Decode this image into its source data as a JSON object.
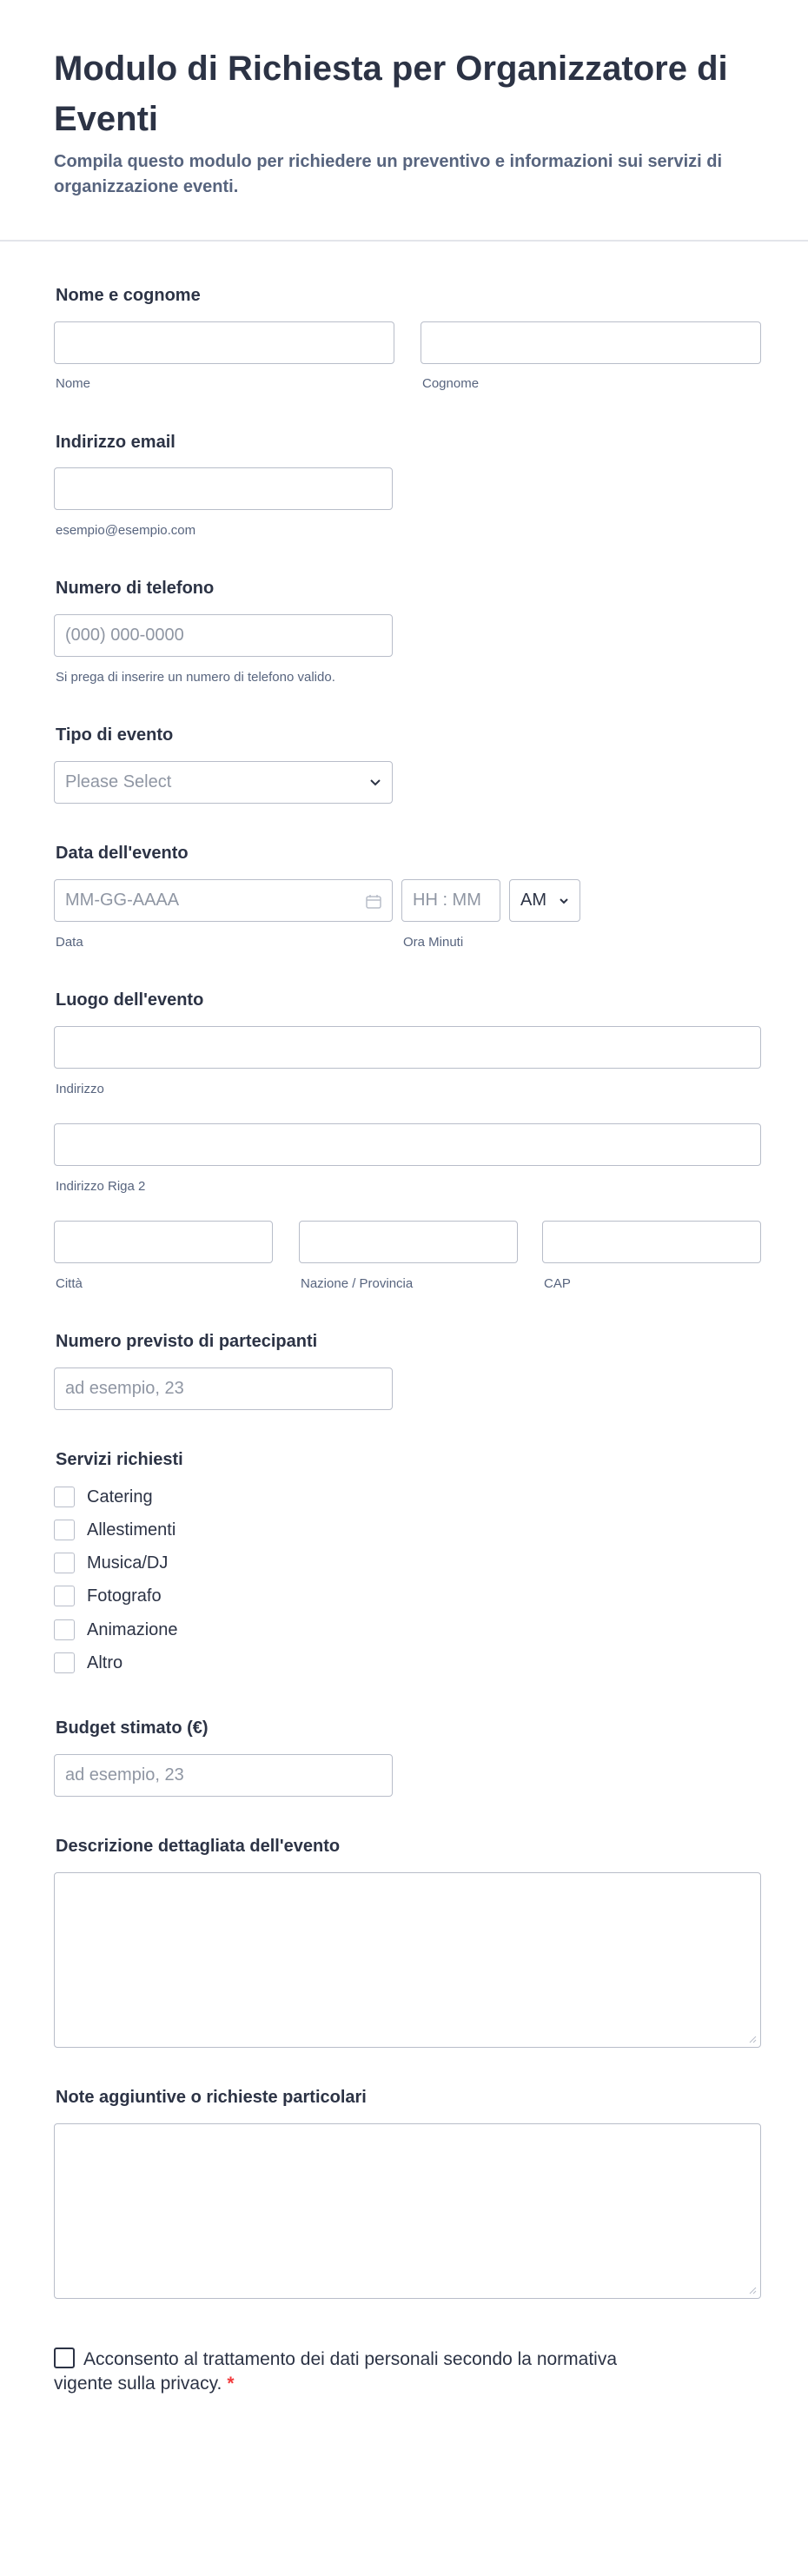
{
  "form": {
    "title": "Modulo di Richiesta per Organizzatore di Eventi",
    "subtitle": "Compila questo modulo per richiedere un preventivo e informazioni sui servizi di organizzazione eventi."
  },
  "name": {
    "label": "Nome e cognome",
    "first_sub": "Nome",
    "last_sub": "Cognome"
  },
  "email": {
    "label": "Indirizzo email",
    "sub": "esempio@esempio.com"
  },
  "phone": {
    "label": "Numero di telefono",
    "placeholder": "(000) 000-0000",
    "sub": "Si prega di inserire un numero di telefono valido."
  },
  "event_type": {
    "label": "Tipo di evento",
    "placeholder": "Please Select"
  },
  "event_date": {
    "label": "Data dell'evento",
    "date_placeholder": "MM-GG-AAAA",
    "time_placeholder": "HH : MM",
    "ampm": "AM",
    "date_sub": "Data",
    "time_sub": "Ora Minuti"
  },
  "location": {
    "label": "Luogo dell'evento",
    "line1_sub": "Indirizzo",
    "line2_sub": "Indirizzo Riga 2",
    "city_sub": "Città",
    "state_sub": "Nazione / Provincia",
    "zip_sub": "CAP"
  },
  "participants": {
    "label": "Numero previsto di partecipanti",
    "placeholder": "ad esempio, 23"
  },
  "services": {
    "label": "Servizi richiesti",
    "options": [
      "Catering",
      "Allestimenti",
      "Musica/DJ",
      "Fotografo",
      "Animazione",
      "Altro"
    ]
  },
  "budget": {
    "label": "Budget stimato (€)",
    "placeholder": "ad esempio, 23"
  },
  "description": {
    "label": "Descrizione dettagliata dell'evento"
  },
  "notes": {
    "label": "Note aggiuntive o richieste particolari"
  },
  "consent": {
    "text": "Acconsento al trattamento dei dati personali secondo la normativa vigente sulla privacy.",
    "required_mark": "*"
  },
  "colors": {
    "text": "#2c3345",
    "muted": "#57647e",
    "border": "#b8bdc9",
    "required": "#f23a3c"
  },
  "icons": {
    "select": "chevron-down-icon",
    "date": "calendar-icon",
    "textarea": "resize-grip-icon"
  }
}
